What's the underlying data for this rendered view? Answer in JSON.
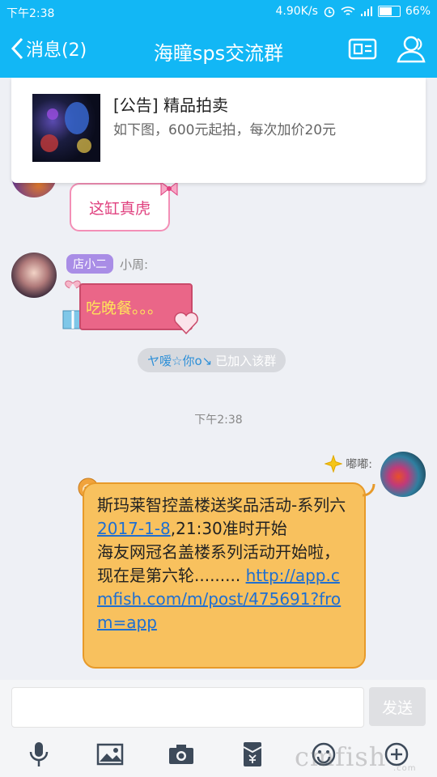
{
  "status_bar": {
    "time": "下午2:38",
    "network_speed": "4.90K/s",
    "battery_text": "66%",
    "battery_level": 0.66
  },
  "header": {
    "back_label": "消息(2)",
    "title": "海瞳sps交流群",
    "icons": [
      "group-profile-icon",
      "members-icon"
    ]
  },
  "announcement": {
    "title": "[公告] 精品拍卖",
    "subtitle": "如下图，600元起拍，每次加价20元"
  },
  "messages": {
    "msg1_text": "这缸真虎",
    "msg2_tag": "店小二",
    "msg2_sender": "小周:",
    "msg2_text": "吃晚餐。。。",
    "system_nick": "ヤ嗳☆你o↘",
    "system_text": "已加入该群",
    "timestamp": "下午2:38",
    "msg3_sender": "嘟嘟:",
    "msg3_line1": "斯玛莱智控盖楼送奖品活动-系列六",
    "msg3_date": "2017-1-8",
    "msg3_line2": ",21:30准时开始",
    "msg3_line3": "海友网冠名盖楼系列活动开始啦，现在是第六轮.........",
    "msg3_link": "http://app.cmfish.com/m/post/475691?from=app"
  },
  "input": {
    "send_label": "发送",
    "tools": [
      "microphone-icon",
      "image-icon",
      "camera-icon",
      "red-envelope-icon",
      "emoji-icon",
      "plus-icon"
    ]
  },
  "colors": {
    "accent": "#12b7f5",
    "bubble_orange": "#f8c15e",
    "link": "#1f6fd1"
  }
}
